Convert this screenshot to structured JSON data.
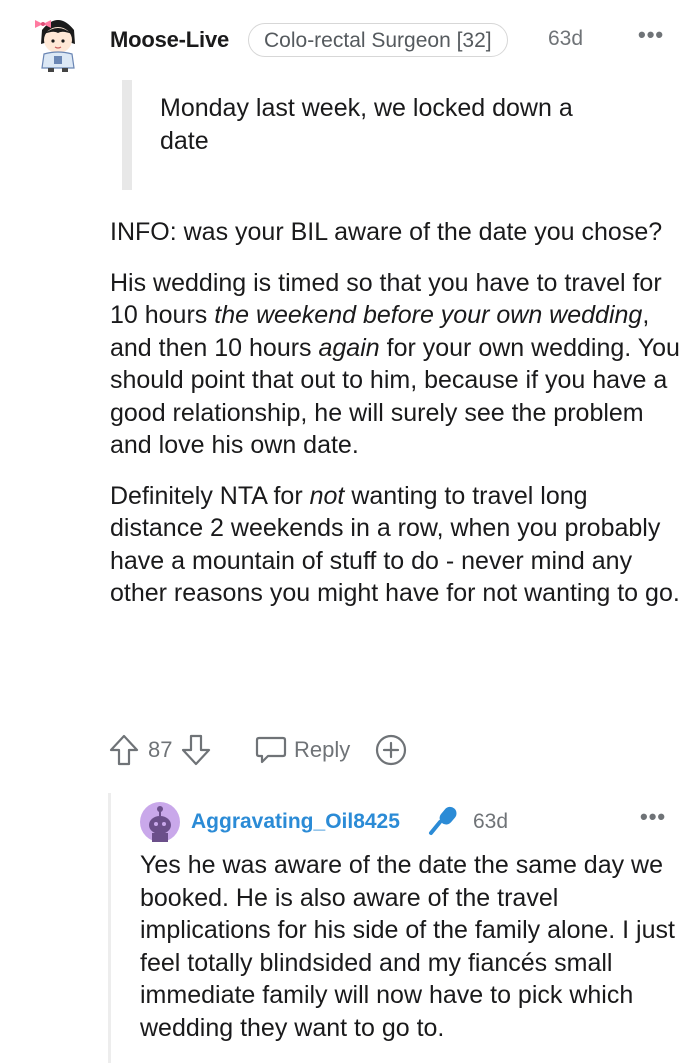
{
  "comment": {
    "username": "Moose-Live",
    "flair": "Colo-rectal Surgeon [32]",
    "age": "63d",
    "more": "•••",
    "quote": "Monday last week, we locked down a date",
    "paragraphs": {
      "p1": "INFO: was your BIL aware of the date you chose?",
      "p2_a": "His wedding is timed so that you have to travel for 10 hours ",
      "p2_em1": "the weekend before your own wedding",
      "p2_b": ", and then 10 hours ",
      "p2_em2": "again",
      "p2_c": " for your own wedding. You should point that out to him, because if you have a good relationship, he will surely see the problem and love his own date.",
      "p3_a": "Definitely NTA for ",
      "p3_em": "not",
      "p3_b": " wanting to travel long distance 2 weekends in a row, when you probably have a mountain of stuff to do - never mind any other reasons you might have for not wanting to go."
    },
    "actions": {
      "score": "87",
      "reply_label": "Reply"
    }
  },
  "reply": {
    "username": "Aggravating_Oil8425",
    "flair_icon": "microphone-icon",
    "age": "63d",
    "more": "•••",
    "text": "Yes he was aware of the date the same day we booked. He is also aware of the travel implications for his side of the family alone. I just feel totally blindsided and my fiancés small immediate family will now have to pick which wedding they want to go to."
  },
  "colors": {
    "username_reply": "#2b8bd6",
    "meta_gray": "#6f7377",
    "quote_bar": "#e8e8e8",
    "avatar_purple": "#c9a8ea"
  }
}
